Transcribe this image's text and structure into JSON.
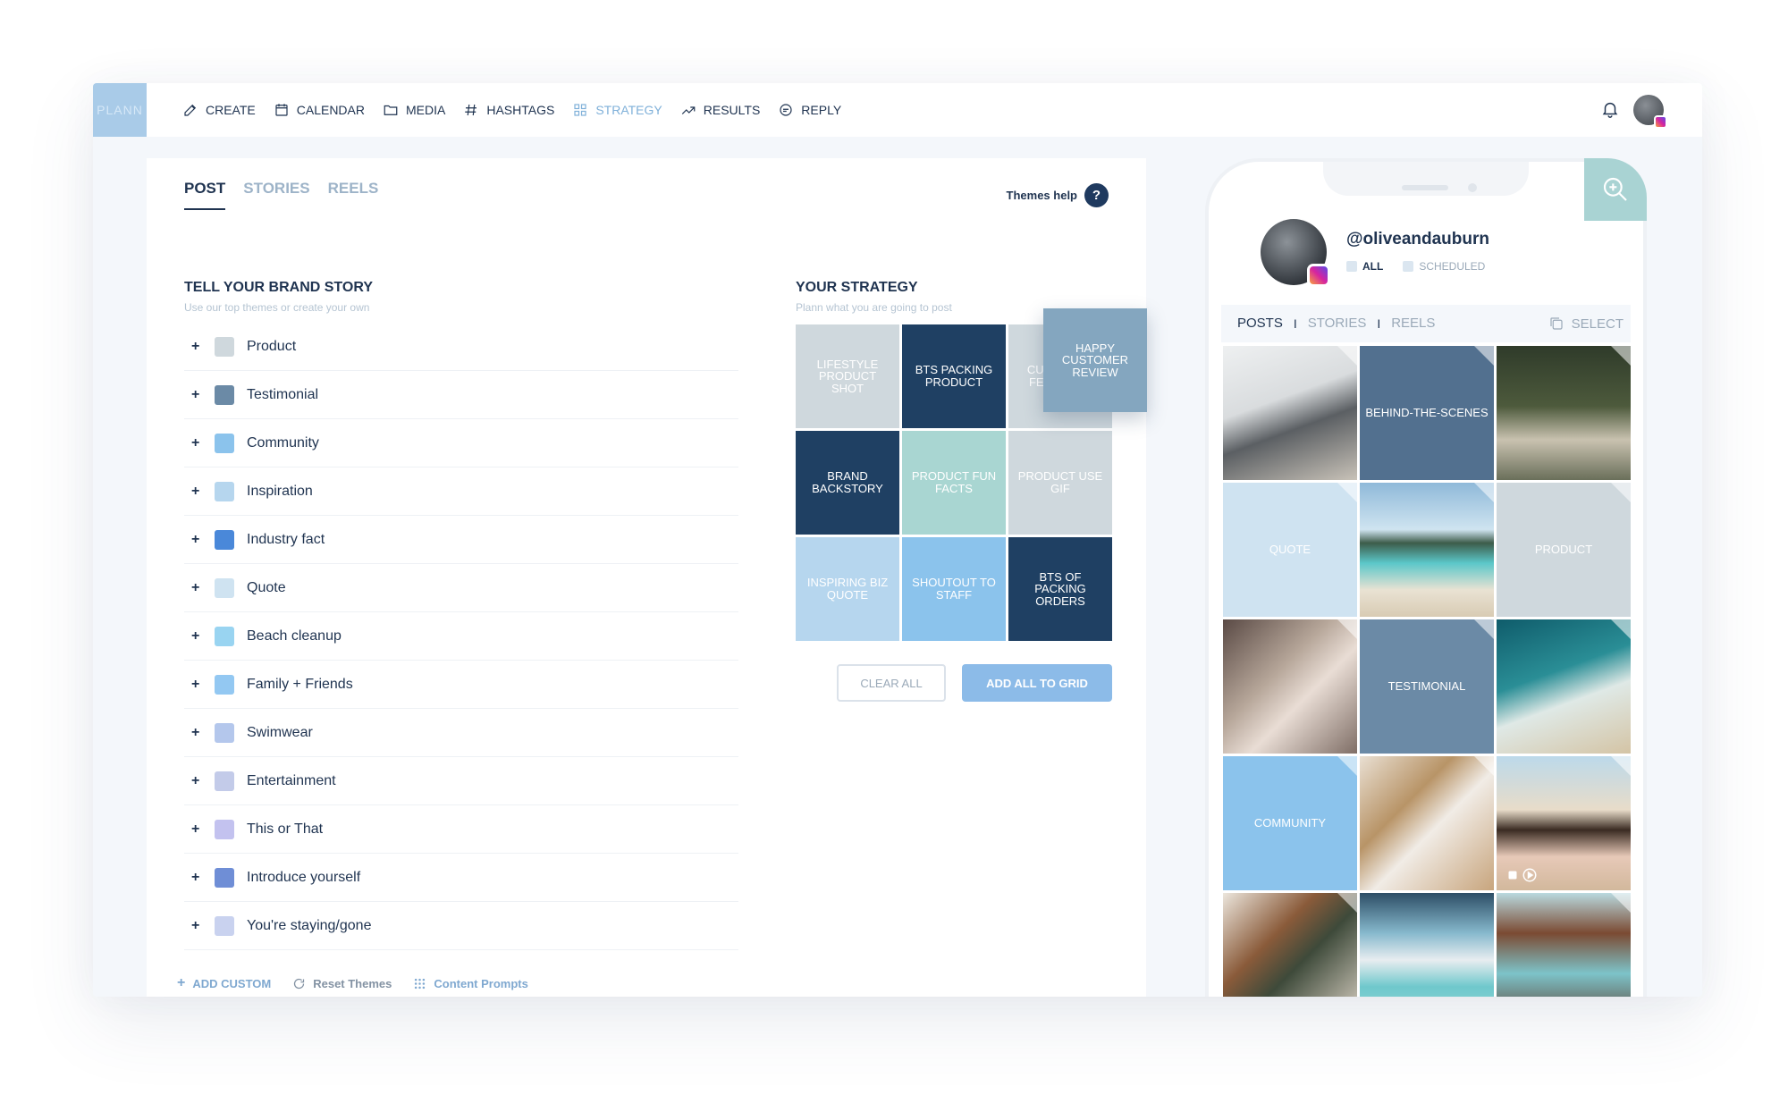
{
  "app": {
    "logo_text": "PLANN"
  },
  "nav": {
    "items": [
      {
        "label": "CREATE",
        "icon": "edit-icon",
        "active": false
      },
      {
        "label": "CALENDAR",
        "icon": "calendar-icon",
        "active": false
      },
      {
        "label": "MEDIA",
        "icon": "folder-icon",
        "active": false
      },
      {
        "label": "HASHTAGS",
        "icon": "hashtag-icon",
        "active": false
      },
      {
        "label": "STRATEGY",
        "icon": "grid-icon",
        "active": true
      },
      {
        "label": "RESULTS",
        "icon": "trend-icon",
        "active": false
      },
      {
        "label": "REPLY",
        "icon": "chat-icon",
        "active": false
      }
    ]
  },
  "panel": {
    "tabs": [
      "POST",
      "STORIES",
      "REELS"
    ],
    "active_tab": "POST",
    "themes_help": "Themes help",
    "help_icon_glyph": "?",
    "brand_story": {
      "title": "TELL YOUR BRAND STORY",
      "subtitle": "Use our top themes or create your own",
      "add_glyph": "+",
      "themes": [
        {
          "label": "Product",
          "color": "#cfd8dd"
        },
        {
          "label": "Testimonial",
          "color": "#6b8aa6"
        },
        {
          "label": "Community",
          "color": "#8bc3ec"
        },
        {
          "label": "Inspiration",
          "color": "#b6d6ee"
        },
        {
          "label": "Industry fact",
          "color": "#4a88d9"
        },
        {
          "label": "Quote",
          "color": "#cfe3f1"
        },
        {
          "label": "Beach cleanup",
          "color": "#99d4f1"
        },
        {
          "label": "Family + Friends",
          "color": "#93c8f2"
        },
        {
          "label": "Swimwear",
          "color": "#b4c7ec"
        },
        {
          "label": "Entertainment",
          "color": "#c3cbe9"
        },
        {
          "label": "This or That",
          "color": "#c3c2ef"
        },
        {
          "label": "Introduce yourself",
          "color": "#6f8ed6"
        },
        {
          "label": "You're staying/gone",
          "color": "#c9d2ef"
        }
      ]
    },
    "strategy": {
      "title": "YOUR STRATEGY",
      "subtitle": "Plann what you are going to post",
      "cells": [
        {
          "label": "LIFESTYLE PRODUCT SHOT",
          "bg": "#cfd8dd",
          "fg": "#ffffff"
        },
        {
          "label": "BTS PACKING PRODUCT",
          "bg": "#1f4063",
          "fg": "#ffffff"
        },
        {
          "label": "CUSTOMER FEEDBACK",
          "bg": "#cfd8dd",
          "fg": "#ffffff"
        },
        {
          "label": "BRAND BACKSTORY",
          "bg": "#1f4063",
          "fg": "#ffffff"
        },
        {
          "label": "PRODUCT FUN FACTS",
          "bg": "#a9d6d2",
          "fg": "#ffffff"
        },
        {
          "label": "PRODUCT USE GIF",
          "bg": "#cfd8dd",
          "fg": "#ffffff"
        },
        {
          "label": "INSPIRING BIZ QUOTE",
          "bg": "#b6d6ee",
          "fg": "#ffffff"
        },
        {
          "label": "SHOUTOUT TO STAFF",
          "bg": "#8bc3ec",
          "fg": "#ffffff"
        },
        {
          "label": "BTS OF PACKING ORDERS",
          "bg": "#1f4063",
          "fg": "#ffffff"
        }
      ],
      "dragging_card": "HAPPY CUSTOMER REVIEW",
      "clear_label": "CLEAR ALL",
      "add_label": "ADD ALL TO GRID"
    },
    "footer": {
      "add_custom": "ADD CUSTOM",
      "add_glyph": "+",
      "reset": "Reset Themes",
      "prompts": "Content Prompts"
    }
  },
  "phone": {
    "handle": "@oliveandauburn",
    "filters": [
      {
        "label": "ALL",
        "active": true
      },
      {
        "label": "SCHEDULED",
        "active": false
      }
    ],
    "tabs": [
      "POSTS",
      "STORIES",
      "REELS"
    ],
    "tab_separator": "I",
    "select_label": "SELECT",
    "feed": [
      {
        "kind": "photo",
        "label": "",
        "name": "office-photo"
      },
      {
        "kind": "theme",
        "label": "BEHIND-THE-SCENES",
        "bg": "#52708f"
      },
      {
        "kind": "photo",
        "label": "",
        "name": "garden-dinner-photo"
      },
      {
        "kind": "theme",
        "label": "QUOTE",
        "bg": "#cfe3f1"
      },
      {
        "kind": "photo",
        "label": "",
        "name": "tropical-beach-photo"
      },
      {
        "kind": "theme",
        "label": "PRODUCT",
        "bg": "#cfd8dd"
      },
      {
        "kind": "photo",
        "label": "",
        "name": "couple-photo"
      },
      {
        "kind": "theme",
        "label": "TESTIMONIAL",
        "bg": "#6b8aa6"
      },
      {
        "kind": "photo",
        "label": "",
        "name": "ocean-waves-photo"
      },
      {
        "kind": "theme",
        "label": "COMMUNITY",
        "bg": "#8bc3ec"
      },
      {
        "kind": "photo",
        "label": "",
        "name": "flatlay-photo"
      },
      {
        "kind": "photo",
        "label": "",
        "name": "friends-beach-photo",
        "video": true
      },
      {
        "kind": "photo",
        "label": "",
        "name": "sandals-photo"
      },
      {
        "kind": "photo",
        "label": "",
        "name": "pool-photo"
      },
      {
        "kind": "photo",
        "label": "",
        "name": "swimsuit-photo"
      }
    ]
  }
}
